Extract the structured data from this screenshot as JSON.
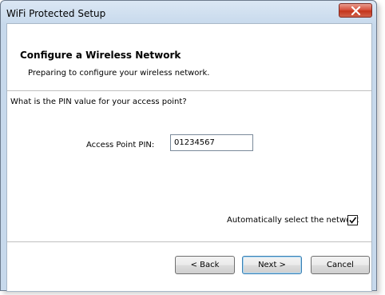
{
  "window": {
    "title": "WiFi Protected Setup",
    "close_label": "X"
  },
  "header": {
    "title": "Configure a Wireless Network",
    "subtitle": "Preparing to configure your wireless network."
  },
  "main": {
    "question": "What is the PIN value for your access point?",
    "pin_label": "Access Point PIN:",
    "pin_value": "01234567",
    "auto_select_label": "Automatically select the network",
    "auto_select_checked": true
  },
  "buttons": {
    "back": "< Back",
    "next": "Next >",
    "cancel": "Cancel"
  },
  "icons": {
    "close": "close-icon",
    "check": "checkmark-icon"
  },
  "colors": {
    "close_button": "#c4351c",
    "title_bar": "#c7d9ec",
    "default_button_border": "#3c7fb1"
  }
}
